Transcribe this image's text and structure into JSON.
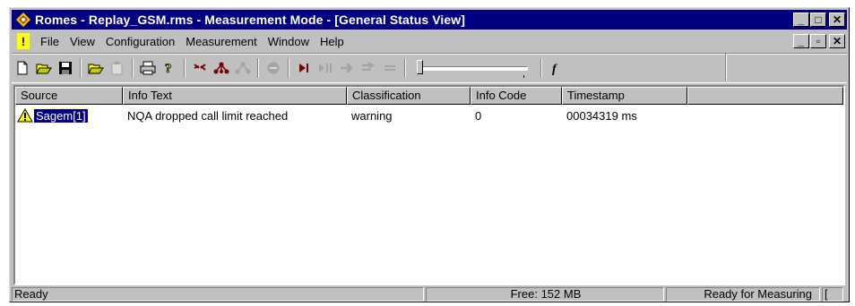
{
  "title_bar": {
    "title": "Romes - Replay_GSM.rms - Measurement Mode - [General Status View]",
    "buttons": [
      "_",
      "□",
      "✕"
    ]
  },
  "menu": {
    "items": [
      "File",
      "View",
      "Configuration",
      "Measurement",
      "Window",
      "Help"
    ],
    "mdi_buttons": [
      "_",
      "▫",
      "✕"
    ]
  },
  "toolbar": {
    "icons": [
      "new-file-icon",
      "open-folder-icon",
      "save-icon",
      "open-config-icon",
      "clipboard-icon",
      "print-icon",
      "help-icon",
      "antenna-icon",
      "network-icon",
      "network-disabled-icon",
      "stop-icon",
      "play-icon",
      "pause-icon",
      "forward-icon",
      "step-icon",
      "list-icon",
      "slider",
      "function-icon"
    ],
    "colors": {
      "active": "#7b0000",
      "disabled": "#808080"
    }
  },
  "table": {
    "columns": [
      "Source",
      "Info Text",
      "Classification",
      "Info Code",
      "Timestamp",
      ""
    ],
    "rows": [
      {
        "source": "Sagem[1]",
        "info_text": "NQA dropped call limit reached",
        "classification": "warning",
        "info_code": "0",
        "timestamp": "00034319 ms"
      }
    ]
  },
  "status_bar": {
    "left": "Ready",
    "memory": "Free: 152 MB",
    "state": "Ready for Measuring",
    "extra": "["
  }
}
